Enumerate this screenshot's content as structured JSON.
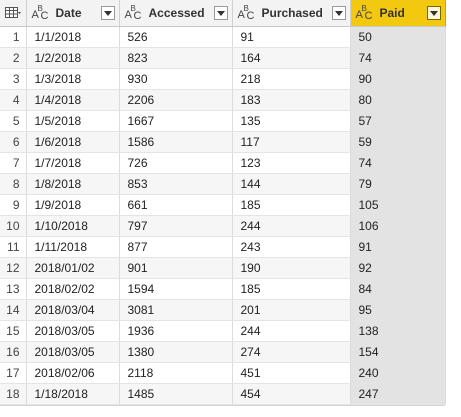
{
  "columns": [
    {
      "name": "Date",
      "type_icon": "text-type-icon"
    },
    {
      "name": "Accessed",
      "type_icon": "text-type-icon"
    },
    {
      "name": "Purchased",
      "type_icon": "text-type-icon"
    },
    {
      "name": "Paid",
      "type_icon": "text-type-icon",
      "selected": true
    }
  ],
  "type_label": {
    "a": "A",
    "b": "B",
    "c": "C"
  },
  "accent_color": "#f2c811",
  "rows": [
    {
      "n": "1",
      "date": "1/1/2018",
      "accessed": "526",
      "purchased": "91",
      "paid": "50"
    },
    {
      "n": "2",
      "date": "1/2/2018",
      "accessed": "823",
      "purchased": "164",
      "paid": "74"
    },
    {
      "n": "3",
      "date": "1/3/2018",
      "accessed": "930",
      "purchased": "218",
      "paid": "90"
    },
    {
      "n": "4",
      "date": "1/4/2018",
      "accessed": "2206",
      "purchased": "183",
      "paid": "80"
    },
    {
      "n": "5",
      "date": "1/5/2018",
      "accessed": "1667",
      "purchased": "135",
      "paid": "57"
    },
    {
      "n": "6",
      "date": "1/6/2018",
      "accessed": "1586",
      "purchased": "117",
      "paid": "59"
    },
    {
      "n": "7",
      "date": "1/7/2018",
      "accessed": "726",
      "purchased": "123",
      "paid": "74"
    },
    {
      "n": "8",
      "date": "1/8/2018",
      "accessed": "853",
      "purchased": "144",
      "paid": "79"
    },
    {
      "n": "9",
      "date": "1/9/2018",
      "accessed": "661",
      "purchased": "185",
      "paid": "105"
    },
    {
      "n": "10",
      "date": "1/10/2018",
      "accessed": "797",
      "purchased": "244",
      "paid": "106"
    },
    {
      "n": "11",
      "date": "1/11/2018",
      "accessed": "877",
      "purchased": "243",
      "paid": "91"
    },
    {
      "n": "12",
      "date": "2018/01/02",
      "accessed": "901",
      "purchased": "190",
      "paid": "92"
    },
    {
      "n": "13",
      "date": "2018/02/02",
      "accessed": "1594",
      "purchased": "185",
      "paid": "84"
    },
    {
      "n": "14",
      "date": "2018/03/04",
      "accessed": "3081",
      "purchased": "201",
      "paid": "95"
    },
    {
      "n": "15",
      "date": "2018/03/05",
      "accessed": "1936",
      "purchased": "244",
      "paid": "138"
    },
    {
      "n": "16",
      "date": "2018/03/05",
      "accessed": "1380",
      "purchased": "274",
      "paid": "154"
    },
    {
      "n": "17",
      "date": "2018/02/06",
      "accessed": "2118",
      "purchased": "451",
      "paid": "240"
    },
    {
      "n": "18",
      "date": "1/18/2018",
      "accessed": "1485",
      "purchased": "454",
      "paid": "247"
    }
  ]
}
